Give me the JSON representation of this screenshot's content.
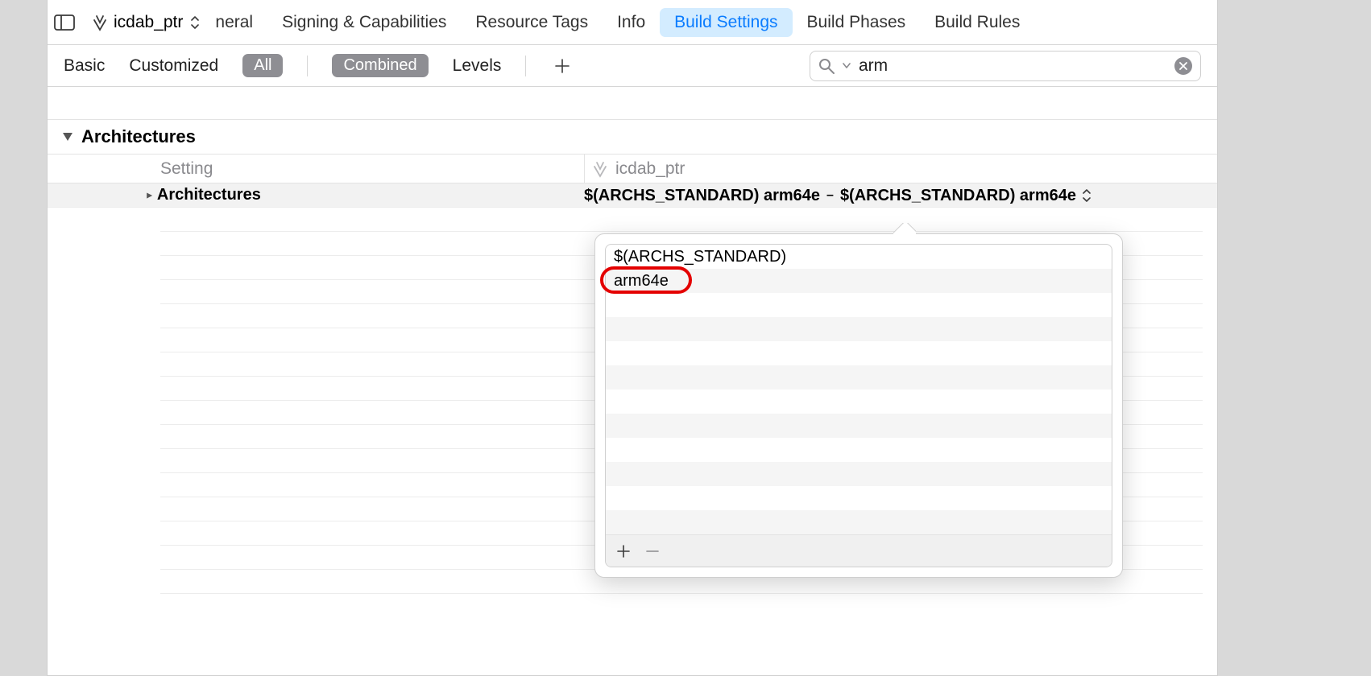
{
  "project": {
    "name": "icdab_ptr"
  },
  "tabs": {
    "partial_first": "neral",
    "items": [
      "Signing & Capabilities",
      "Resource Tags",
      "Info",
      "Build Settings",
      "Build Phases",
      "Build Rules"
    ],
    "active_index": 3
  },
  "filterbar": {
    "basic": "Basic",
    "customized": "Customized",
    "all_pill": "All",
    "combined_pill": "Combined",
    "levels": "Levels"
  },
  "search": {
    "value": "arm",
    "placeholder": "Search"
  },
  "section": {
    "title": "Architectures"
  },
  "columns": {
    "setting": "Setting",
    "target_name": "icdab_ptr"
  },
  "setting_row": {
    "name": "Architectures",
    "resolved": "$(ARCHS_STANDARD) arm64e",
    "effective": "$(ARCHS_STANDARD) arm64e"
  },
  "popover": {
    "items": [
      "$(ARCHS_STANDARD)",
      "arm64e"
    ],
    "highlighted_index": 1
  }
}
